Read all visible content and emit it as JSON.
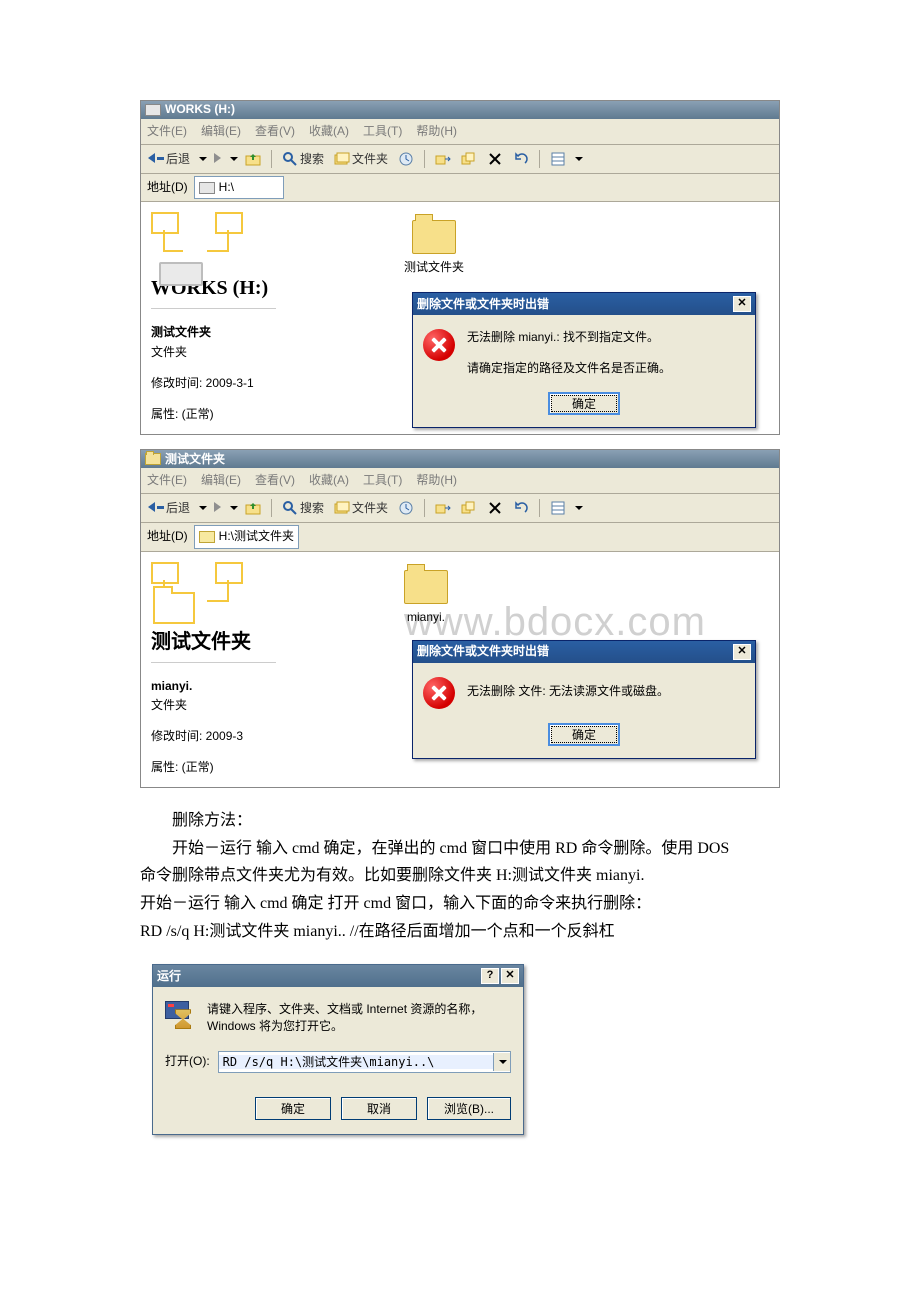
{
  "menus": {
    "file": "文件(E)",
    "edit": "编辑(E)",
    "view": "查看(V)",
    "fav": "收藏(A)",
    "tools": "工具(T)",
    "help": "帮助(H)"
  },
  "toolbar": {
    "back": "后退",
    "search": "搜索",
    "folders": "文件夹"
  },
  "address_label": "地址(D)",
  "shot1": {
    "title": "WORKS (H:)",
    "addr_value": "H:\\",
    "pane_title": "WORKS (H:)",
    "folder_name": "测试文件夹",
    "selected_name": "测试文件夹",
    "selected_type": "文件夹",
    "modified": "修改时间: 2009-3-1",
    "attrs": "属性: (正常)",
    "dlg_title": "删除文件或文件夹时出错",
    "dlg_line1": "无法删除 mianyi.: 找不到指定文件。",
    "dlg_line2": "请确定指定的路径及文件名是否正确。",
    "dlg_ok": "确定"
  },
  "shot2": {
    "title": "测试文件夹",
    "addr_value": "H:\\测试文件夹",
    "pane_title": "测试文件夹",
    "folder_name": "mianyi.",
    "selected_name": "mianyi.",
    "selected_type": "文件夹",
    "modified": "修改时间: 2009-3",
    "attrs": "属性: (正常)",
    "dlg_title": "删除文件或文件夹时出错",
    "dlg_line1": "无法删除 文件: 无法读源文件或磁盘。",
    "dlg_ok": "确定",
    "watermark": "www.bdocx.com"
  },
  "body": {
    "p1": "删除方法：",
    "p2": "开始－运行 输入 cmd 确定，在弹出的 cmd 窗口中使用 RD 命令删除。使用 DOS",
    "p3": "命令删除带点文件夹尤为有效。比如要删除文件夹 H:测试文件夹 mianyi.",
    "p4": "开始－运行 输入 cmd 确定 打开 cmd 窗口，输入下面的命令来执行删除：",
    "p5": "RD /s/q H:测试文件夹 mianyi.. //在路径后面增加一个点和一个反斜杠"
  },
  "run": {
    "title": "运行",
    "desc": "请键入程序、文件夹、文档或 Internet 资源的名称，Windows 将为您打开它。",
    "open_label": "打开(O):",
    "value": "RD /s/q H:\\测试文件夹\\mianyi..\\",
    "ok": "确定",
    "cancel": "取消",
    "browse": "浏览(B)..."
  }
}
